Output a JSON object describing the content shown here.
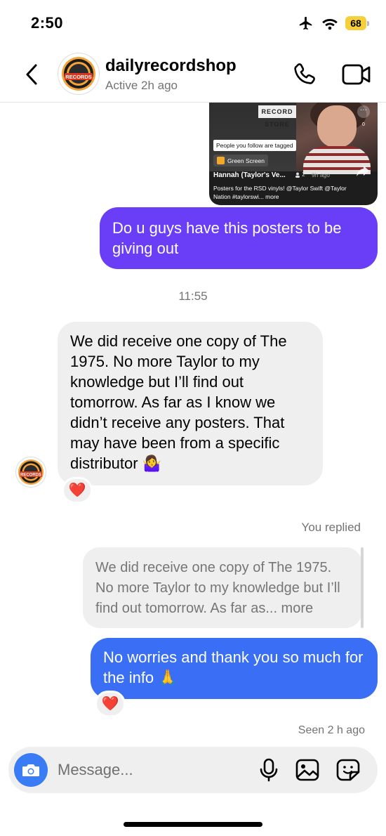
{
  "status_bar": {
    "time": "2:50",
    "battery": "68",
    "icons": [
      "airplane-icon",
      "wifi-icon",
      "battery-icon"
    ]
  },
  "header": {
    "name": "dailyrecordshop",
    "subtitle": "Active 2h ago",
    "avatar_logo_text": "RECORDS"
  },
  "shared_reel": {
    "store_sign": "RECORD STORE",
    "tag_label": "People you follow are tagged",
    "effect_label": "Green Screen",
    "author": "Hannah (Taylor's Ve...",
    "people_count": "2",
    "time_ago": "9h ago",
    "caption": "Posters for the RSD vinyls! @Taylor Swift @Taylor Nation #taylorswi... more",
    "side_counts": [
      "0",
      "3"
    ]
  },
  "messages": {
    "sent_1": "Do u guys have this posters to be giving out",
    "timestamp": "11:55",
    "received_1": "We did receive one copy of The 1975. No more Taylor to my knowledge but I’ll find out tomorrow. As far as I know we didn’t receive any posters. That may have been from a specific distributor 🤷‍♀️",
    "reaction_1": "❤️",
    "you_replied": "You replied",
    "quoted": "We did receive one copy of The 1975. No more Taylor to my knowledge but I’ll find out tomorrow. As far as... more",
    "sent_2": "No worries and thank you so much for the info 🙏",
    "reaction_2": "❤️",
    "seen": "Seen 2 h ago"
  },
  "composer": {
    "placeholder": "Message..."
  },
  "colors": {
    "sent_bubble_1": "#6a3df6",
    "sent_bubble_2": "#3a6ff5",
    "received_bubble": "#efefef",
    "camera_button": "#3a7bf6",
    "battery": "#f5d03b"
  }
}
